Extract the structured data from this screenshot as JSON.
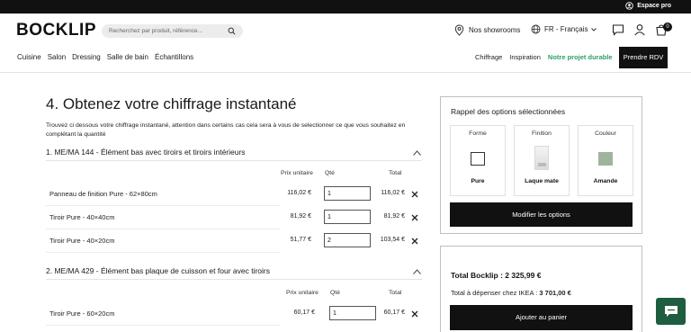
{
  "topbar": {
    "espace_pro": "Espace pro",
    "icon": "user-circle-icon"
  },
  "header": {
    "logo": "BOCKLIP",
    "search_placeholder": "Recherchez par produit, référence...",
    "showrooms": "Nos showrooms",
    "language": "FR - Français",
    "cart_count": "0",
    "icons": [
      "map-pin-icon",
      "globe-icon",
      "chat-icon",
      "account-icon",
      "cart-icon"
    ]
  },
  "nav": {
    "left": [
      "Cuisine",
      "Salon",
      "Dressing",
      "Salle de bain",
      "Échantillons"
    ],
    "right": [
      "Chiffrage",
      "Inspiration",
      "Notre projet durable"
    ],
    "rdv": "Prendre RDV"
  },
  "main": {
    "title": "4. Obtenez votre chiffrage instantané",
    "intro": "Trouvez ci dessous votre chiffrage instantané, attention dans certains cas cela sera à vous de selectionner ce que vous souhaitez en complétant la quantité",
    "sections": [
      {
        "title": "1. ME/MA 144 - Élément bas avec tiroirs et tiroirs intérieurs",
        "headers": {
          "price": "Prix unitaire",
          "qty": "Qté",
          "total": "Total"
        },
        "rows": [
          {
            "name": "Panneau de finition Pure - 62×80cm",
            "price": "116,02 €",
            "qty": "1",
            "total": "116,02 €"
          },
          {
            "name": "Tiroir Pure - 40×40cm",
            "price": "81,92 €",
            "qty": "1",
            "total": "81,92 €"
          },
          {
            "name": "Tiroir Pure - 40×20cm",
            "price": "51,77 €",
            "qty": "2",
            "total": "103,54 €"
          }
        ]
      },
      {
        "title": "2. ME/MA 429 - Élément bas plaque de cuisson et four avec tiroirs",
        "headers": {
          "price": "Prix unitaire",
          "qty": "Qté",
          "total": "Total"
        },
        "rows": [
          {
            "name": "Tiroir Pure - 60×20cm",
            "price": "60,17 €",
            "qty": "1",
            "total": "60,17 €"
          }
        ]
      }
    ]
  },
  "options_panel": {
    "title": "Rappel des options sélectionnées",
    "cards": [
      {
        "label": "Forme",
        "value": "Pure"
      },
      {
        "label": "Finition",
        "value": "Laque mate"
      },
      {
        "label": "Couleur",
        "value": "Amande",
        "color": "#9fb49c"
      }
    ],
    "button": "Modifier les options"
  },
  "total_panel": {
    "total_label": "Total Bocklip : 2 325,99 €",
    "ikea_label": "Total à dépenser chez IKEA : ",
    "ikea_value": "3 701,00 €",
    "button": "Ajouter au panier"
  },
  "colors": {
    "accent_green": "#2f9e67",
    "chat_green": "#1e5d3f",
    "dark": "#111111"
  }
}
